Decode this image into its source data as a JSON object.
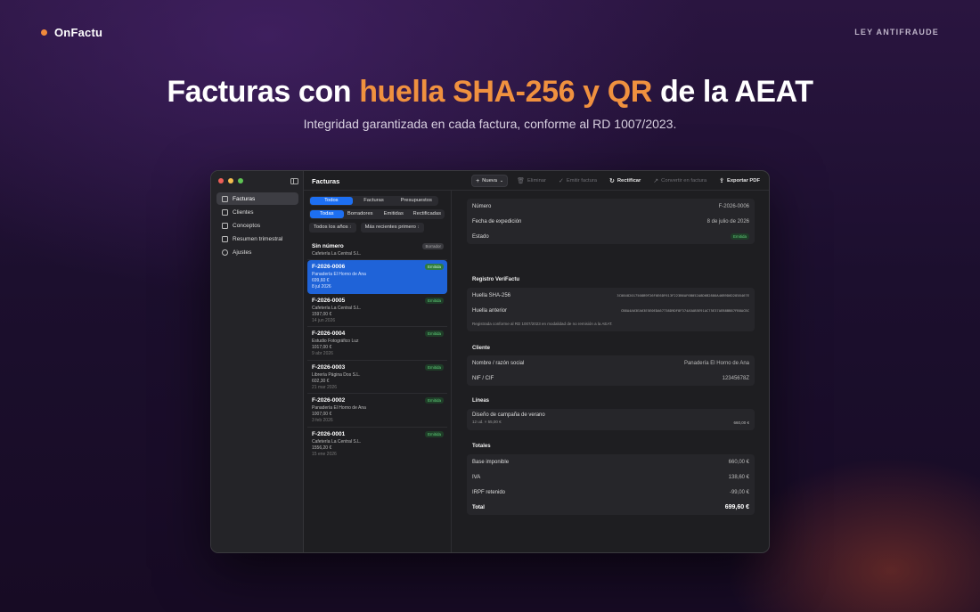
{
  "brand": {
    "name": "OnFactu"
  },
  "nav_link": "LEY ANTIFRAUDE",
  "hero": {
    "title_pre": "Facturas con",
    "title_highlight": "huella SHA-256 y QR",
    "title_post": "de la AEAT",
    "subtitle": "Integridad garantizada en cada factura, conforme al RD 1007/2023."
  },
  "colors": {
    "accent": "#f0913f",
    "selection": "#1f63d8",
    "badge_green": "#5fd079"
  },
  "sidebar": {
    "items": [
      {
        "label": "Facturas",
        "icon": "document-icon",
        "active": true
      },
      {
        "label": "Clientes",
        "icon": "people-icon"
      },
      {
        "label": "Conceptos",
        "icon": "list-icon"
      },
      {
        "label": "Resumen trimestral",
        "icon": "chart-icon"
      },
      {
        "label": "Ajustes",
        "icon": "gear-icon"
      }
    ]
  },
  "toolbar": {
    "title": "Facturas",
    "new_label": "Nueva",
    "delete_label": "Eliminar",
    "emit_label": "Emitir factura",
    "rectify_label": "Rectificar",
    "convert_label": "Convertir en factura",
    "export_label": "Exportar PDF"
  },
  "list": {
    "type_tabs": [
      "Todos",
      "Facturas",
      "Presupuestos"
    ],
    "state_tabs": [
      "Todas",
      "Borradores",
      "Emitidas",
      "Rectificadas"
    ],
    "year_filter": "Todos los años",
    "sort_filter": "Más recientes primero",
    "items": [
      {
        "number": "Sin número",
        "client": "Cafetería La Central S.L.",
        "badge": "Borrador"
      },
      {
        "number": "F-2026-0006",
        "client": "Panadería El Horno de Ana",
        "amount": "699,60 €",
        "date": "8 jul 2026",
        "badge": "Emitida"
      },
      {
        "number": "F-2026-0005",
        "client": "Cafetería La Central S.L.",
        "amount": "1597,00 €",
        "date": "14 jun 2026",
        "badge": "Emitida"
      },
      {
        "number": "F-2026-0004",
        "client": "Estudio Fotográfico Luz",
        "amount": "1017,00 €",
        "date": "9 abr 2026",
        "badge": "Emitida"
      },
      {
        "number": "F-2026-0003",
        "client": "Librería Página Dos S.L.",
        "amount": "602,30 €",
        "date": "21 mar 2026",
        "badge": "Emitida"
      },
      {
        "number": "F-2026-0002",
        "client": "Panadería El Horno de Ana",
        "amount": "1007,00 €",
        "date": "3 feb 2026",
        "badge": "Emitida"
      },
      {
        "number": "F-2026-0001",
        "client": "Cafetería La Central S.L.",
        "amount": "1556,20 €",
        "date": "15 ene 2026",
        "badge": "Emitida"
      }
    ]
  },
  "detail": {
    "numero_label": "Número",
    "numero": "F-2026-0006",
    "fecha_label": "Fecha de expedición",
    "fecha": "8 de julio de 2026",
    "estado_label": "Estado",
    "estado": "Emitida",
    "verifactu_title": "Registro VeriFactu",
    "huella_label": "Huella SHA-256",
    "huella": "3C08482017508B9F26F0E6DF613F223B6AF6B052A8D6B2880A46B9D6D2858467E",
    "huella_ant_label": "Huella anterior",
    "huella_ant": "CB8A4A63EA63E5E0EDA67738D9DF8F374A5AB5E91AC75E37AEB8BB87FB8ACBC",
    "verifactu_note": "Registrada conforme al RD 1007/2023 en modalidad de no remisión a la AEAT.",
    "cliente_title": "Cliente",
    "nombre_label": "Nombre / razón social",
    "nombre": "Panadería El Horno de Ana",
    "nif_label": "NIF / CIF",
    "nif": "12345678Z",
    "lineas_title": "Líneas",
    "linea_desc": "Diseño de campaña de verano",
    "linea_sub": "12 ud. × 55,00 €",
    "linea_amt": "660,00 €",
    "totales_title": "Totales",
    "base_label": "Base imponible",
    "base": "660,00 €",
    "iva_label": "IVA",
    "iva": "138,60 €",
    "irpf_label": "IRPF retenido",
    "irpf": "-99,00 €",
    "total_label": "Total",
    "total": "699,60 €"
  }
}
